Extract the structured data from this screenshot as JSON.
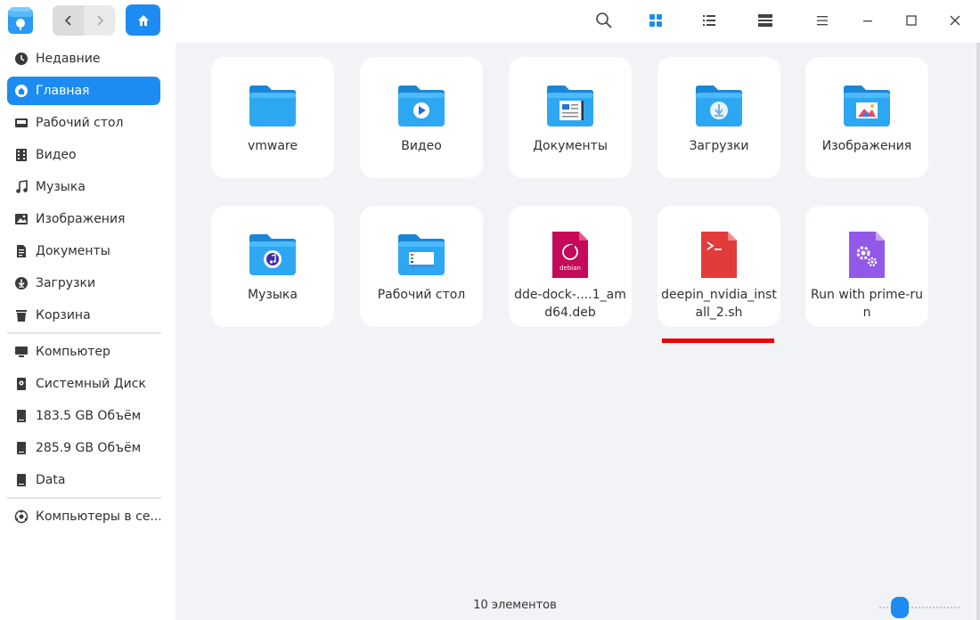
{
  "sidebar": {
    "items": [
      {
        "label": "Недавние",
        "icon": "clock-icon"
      },
      {
        "label": "Главная",
        "icon": "home-icon"
      },
      {
        "label": "Рабочий стол",
        "icon": "desktop-icon"
      },
      {
        "label": "Видео",
        "icon": "film-icon"
      },
      {
        "label": "Музыка",
        "icon": "music-note-icon"
      },
      {
        "label": "Изображения",
        "icon": "picture-icon"
      },
      {
        "label": "Документы",
        "icon": "document-icon"
      },
      {
        "label": "Загрузки",
        "icon": "download-icon"
      },
      {
        "label": "Корзина",
        "icon": "trash-icon"
      }
    ],
    "devices": [
      {
        "label": "Компьютер",
        "icon": "computer-icon"
      },
      {
        "label": "Системный Диск",
        "icon": "system-disk-icon"
      },
      {
        "label": "183.5 GB Объём",
        "icon": "drive-icon"
      },
      {
        "label": "285.9 GB Объём",
        "icon": "drive-icon"
      },
      {
        "label": "Data",
        "icon": "drive-icon"
      }
    ],
    "network": [
      {
        "label": "Компьютеры в се...",
        "icon": "network-icon"
      }
    ],
    "active_index": 1
  },
  "files": [
    {
      "name": "vmware",
      "icon": "folder-icon"
    },
    {
      "name": "Видео",
      "icon": "video-folder-icon"
    },
    {
      "name": "Документы",
      "icon": "documents-folder-icon"
    },
    {
      "name": "Загрузки",
      "icon": "downloads-folder-icon"
    },
    {
      "name": "Изображения",
      "icon": "pictures-folder-icon"
    },
    {
      "name": "Музыка",
      "icon": "music-folder-icon"
    },
    {
      "name": "Рабочий стол",
      "icon": "desktop-folder-icon"
    },
    {
      "name": "dde-dock-....1_amd64.deb",
      "icon": "debian-package-icon"
    },
    {
      "name": "deepin_nvidia_install_2.sh",
      "icon": "shell-script-icon"
    },
    {
      "name": "Run with prime-run",
      "icon": "settings-app-icon"
    }
  ],
  "status": {
    "item_count": "10 элементов"
  },
  "colors": {
    "accent": "#1c8cf2",
    "folder": "#2ea7f2",
    "highlight": "#ee0000"
  }
}
